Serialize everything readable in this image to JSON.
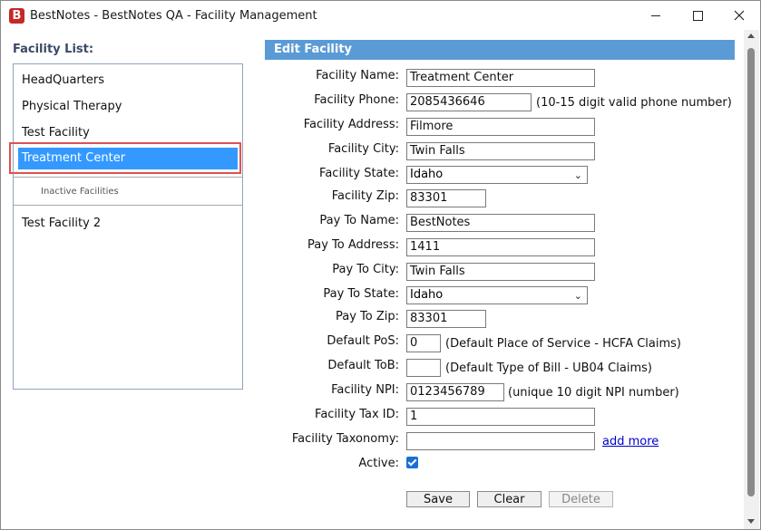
{
  "window": {
    "app_icon": "B",
    "title": "BestNotes - BestNotes QA - Facility Management"
  },
  "sidebar": {
    "label": "Facility List:",
    "items": [
      {
        "label": "HeadQuarters"
      },
      {
        "label": "Physical Therapy"
      },
      {
        "label": "Test Facility"
      },
      {
        "label": "Treatment Center"
      }
    ],
    "inactive_header": "Inactive Facilities",
    "inactive_items": [
      {
        "label": "Test Facility 2"
      }
    ]
  },
  "form": {
    "header": "Edit Facility",
    "facility_name_label": "Facility Name:",
    "facility_name": "Treatment Center",
    "facility_phone_label": "Facility Phone:",
    "facility_phone": "2085436646",
    "facility_phone_hint": "(10-15 digit valid phone number)",
    "facility_address_label": "Facility Address:",
    "facility_address": "Filmore",
    "facility_city_label": "Facility City:",
    "facility_city": "Twin Falls",
    "facility_state_label": "Facility State:",
    "facility_state": "Idaho",
    "facility_zip_label": "Facility Zip:",
    "facility_zip": "83301",
    "pay_to_name_label": "Pay To Name:",
    "pay_to_name": "BestNotes",
    "pay_to_address_label": "Pay To Address:",
    "pay_to_address": "1411",
    "pay_to_city_label": "Pay To City:",
    "pay_to_city": "Twin Falls",
    "pay_to_state_label": "Pay To State:",
    "pay_to_state": "Idaho",
    "pay_to_zip_label": "Pay To Zip:",
    "pay_to_zip": "83301",
    "default_pos_label": "Default PoS:",
    "default_pos": "0",
    "default_pos_hint": "(Default Place of Service - HCFA Claims)",
    "default_tob_label": "Default ToB:",
    "default_tob": "",
    "default_tob_hint": "(Default Type of Bill - UB04 Claims)",
    "facility_npi_label": "Facility NPI:",
    "facility_npi": "0123456789",
    "facility_npi_hint": "(unique 10 digit NPI number)",
    "facility_tax_id_label": "Facility Tax ID:",
    "facility_tax_id": "1",
    "facility_taxonomy_label": "Facility Taxonomy:",
    "facility_taxonomy": "",
    "add_more_link": "add more",
    "active_label": "Active:",
    "active": true
  },
  "buttons": {
    "save": "Save",
    "clear": "Clear",
    "delete": "Delete"
  },
  "colors": {
    "selected_item": "#3399ff",
    "header_bar": "#5b9bd5",
    "highlight_box": "#e05050",
    "link": "#0000cc"
  },
  "icons": {
    "minimize": "minimize-icon",
    "maximize": "maximize-icon",
    "close": "close-icon",
    "dropdown": "chevron-down-icon",
    "checkbox": "checkmark-icon"
  }
}
